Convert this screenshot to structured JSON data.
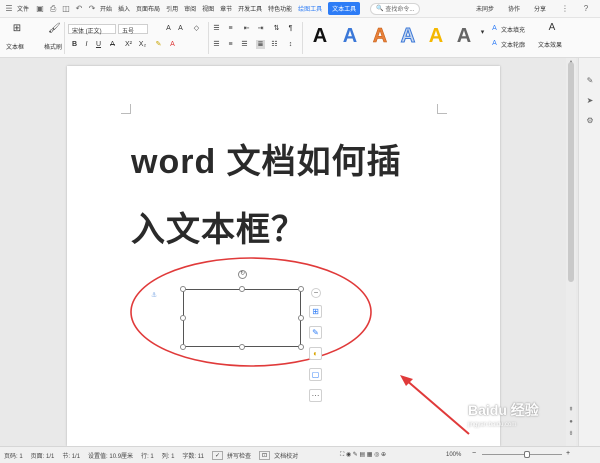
{
  "menubar": {
    "file_menu": "文件",
    "tabs": [
      "开始",
      "插入",
      "页面布局",
      "引用",
      "审阅",
      "视图",
      "章节",
      "开发工具",
      "特色功能"
    ],
    "context_tabs": [
      "绘图工具"
    ],
    "active_tab": "文本工具",
    "search_placeholder": "查找命令...",
    "right_actions": [
      "未同步",
      "协作",
      "分享"
    ]
  },
  "ribbon": {
    "textbox_label": "文本框",
    "format_brush_label": "格式刷",
    "font_name": "宋体 (正文)",
    "font_size": "五号",
    "text_fill_label": "文本填充",
    "text_outline_label": "文本轮廓",
    "text_effect_label": "文本效果",
    "wordart_style_count": 6,
    "wordart_letter": "A"
  },
  "colors": {
    "accent": "#2d7cf6",
    "ellipse": "#e03a3a",
    "arrow": "#e03a3a",
    "wordart_styles": [
      "#111111",
      "#3b78d8",
      "#e8803a",
      "#c6d6ee",
      "#f4b700",
      "#666666"
    ]
  },
  "document": {
    "heading_line1": "word 文档如何插",
    "heading_line2": "入文本框？"
  },
  "statusbar": {
    "page_num": "页码: 1",
    "pages": "页面: 1/1",
    "section": "节: 1/1",
    "setting": "设置值: 10.9厘米",
    "row": "行: 1",
    "col": "列: 1",
    "word_count": "字数: 11",
    "spell_check": "拼写检查",
    "doc_proof": "文档校对",
    "zoom": "100%"
  },
  "watermark": {
    "brand": "Baidu 经验",
    "url": "jingyan.baidu.com"
  },
  "icons": {
    "quick": [
      "menu-icon",
      "save-icon",
      "print-icon",
      "preview-icon",
      "undo-icon",
      "redo-icon"
    ],
    "floatbar": [
      "layout-icon",
      "edit-icon",
      "fill-icon",
      "outline-icon",
      "more-icon"
    ],
    "rpane": [
      "pen-icon",
      "cursor-icon",
      "settings-icon"
    ]
  }
}
